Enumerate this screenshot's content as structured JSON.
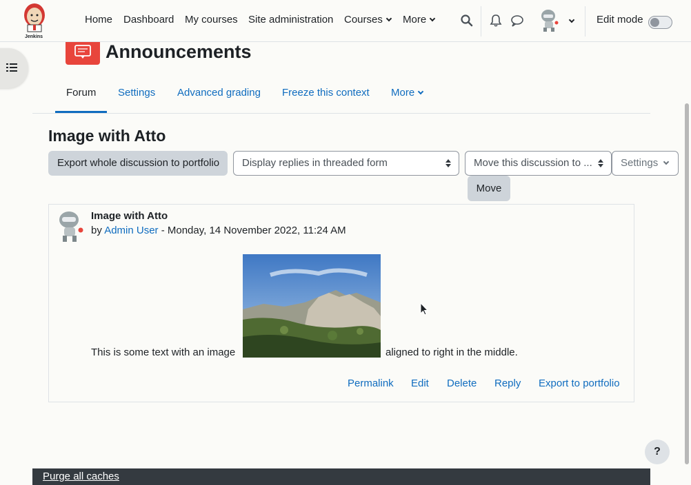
{
  "navbar": {
    "logo_text": "Jenkins",
    "links": [
      "Home",
      "Dashboard",
      "My courses",
      "Site administration"
    ],
    "courses_label": "Courses",
    "more_label": "More",
    "edit_mode_label": "Edit mode",
    "edit_mode_on": false
  },
  "header": {
    "title": "Announcements",
    "icon": "forum-icon"
  },
  "tabs": {
    "forum": "Forum",
    "settings": "Settings",
    "advanced_grading": "Advanced grading",
    "freeze": "Freeze this context",
    "more": "More"
  },
  "discussion": {
    "title": "Image with Atto",
    "export_button": "Export whole discussion to portfolio",
    "display_select": "Display replies in threaded form",
    "move_select": "Move this discussion to ...",
    "settings_button": "Settings",
    "move_button": "Move"
  },
  "post": {
    "subject": "Image with Atto",
    "by": "by ",
    "author": "Admin User",
    "date": " - Monday, 14 November 2022, 11:24 AM",
    "text_before": "This is some text with an image",
    "text_after": "aligned to right in the middle.",
    "actions": {
      "permalink": "Permalink",
      "edit": "Edit",
      "delete": "Delete",
      "reply": "Reply",
      "export": "Export to portfolio"
    }
  },
  "footer": {
    "purge": "Purge all caches"
  },
  "help": {
    "label": "?"
  },
  "colors": {
    "link": "#0f6cbf",
    "accent_red": "#e8453c",
    "footer_bg": "#343a40"
  }
}
